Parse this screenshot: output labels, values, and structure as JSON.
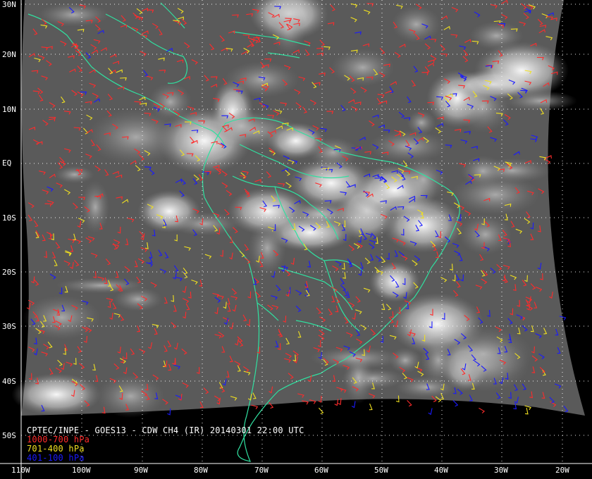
{
  "caption": {
    "title": "CPTEC/INPE - GOES13 - CDW CH4 (IR) 20140301 22:00 UTC",
    "title_color": "#ffffff"
  },
  "legend": [
    {
      "label": "1000-700 hPa",
      "color": "#ff2b2b"
    },
    {
      "label": "701-400 hPa",
      "color": "#f0e020"
    },
    {
      "label": "401-100 hPa",
      "color": "#1a1aff"
    }
  ],
  "axes": {
    "lat_labels": [
      "30N",
      "20N",
      "10N",
      "EQ",
      "10S",
      "20S",
      "30S",
      "40S",
      "50S"
    ],
    "lon_labels": [
      "110W",
      "100W",
      "90W",
      "80W",
      "70W",
      "60W",
      "50W",
      "40W",
      "30W",
      "20W"
    ],
    "grid": true,
    "grid_style": "dotted",
    "grid_color": "#ffffff"
  },
  "map": {
    "background": "#000000",
    "coastline_color": "#30e0a0",
    "satellite_imagery": "infrared cloud imagery"
  }
}
